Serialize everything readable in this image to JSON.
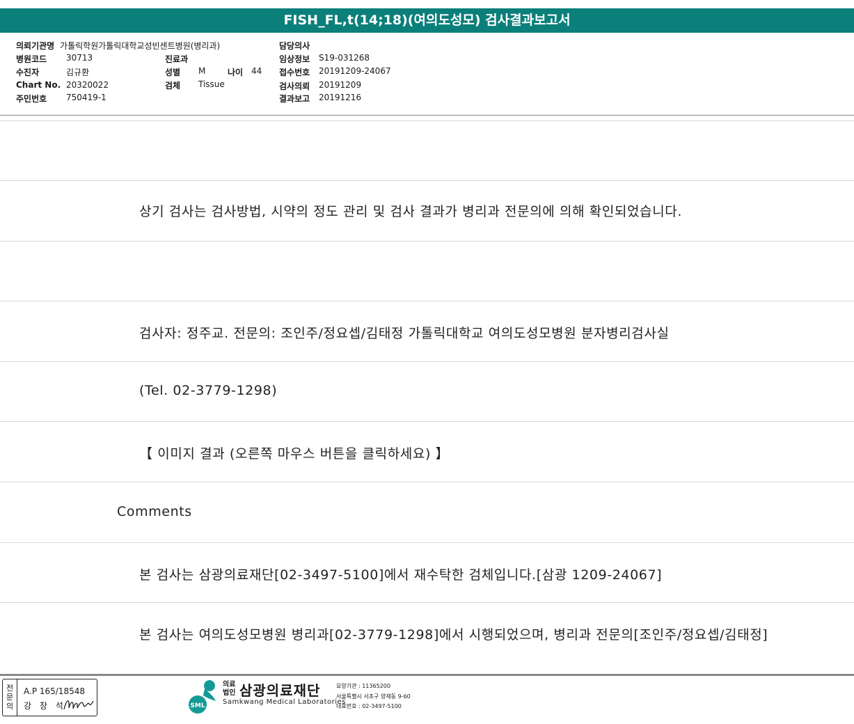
{
  "title": "FISH_FL,t(14;18)(여의도성모) 검사결과보고서",
  "header": {
    "institution_label": "의뢰기관명",
    "institution_value": "가톨릭학원가톨릭대학교성빈센트병원(병리과)",
    "hospital_code_label": "병원코드",
    "hospital_code_value": "30713",
    "recipient_label": "수진자",
    "recipient_value": "김규환",
    "chart_no_label": "Chart No.",
    "chart_no_value": "20320022",
    "resident_no_label": "주민번호",
    "resident_no_value": "750419-1",
    "department_label": "진료과",
    "department_value": "",
    "sex_label": "성별",
    "sex_value": "M",
    "age_label": "나이",
    "age_value": "44",
    "specimen_label": "검체",
    "specimen_value": "Tissue",
    "doctor_label": "담당의사",
    "doctor_value": "",
    "clinical_info_label": "임상정보",
    "clinical_info_value": "S19-031268",
    "receipt_no_label": "접수번호",
    "receipt_no_value": "20191209-24067",
    "test_request_label": "검사의뢰",
    "test_request_value": "20191209",
    "result_report_label": "결과보고",
    "result_report_value": "20191216"
  },
  "body": {
    "line_confirm": "상기 검사는 검사방법, 시약의 정도 관리 및 검사 결과가 병리과 전문의에 의해 확인되었습니다.",
    "line_examiner": "검사자: 정주교. 전문의: 조인주/정요셉/김태정 가톨릭대학교 여의도성모병원 분자병리검사실",
    "line_tel": "(Tel. 02-3779-1298)",
    "line_image": "【 이미지 결과 (오른쪽 마우스 버튼을 클릭하세요) 】",
    "comments_heading": "Comments",
    "line_outsourced": "본 검사는 삼광의료재단[02-3497-5100]에서 재수탁한 검체입니다.[삼광 1209-24067]",
    "line_performed": "본 검사는 여의도성모병원 병리과[02-3779-1298]에서 시행되었으며, 병리과 전문의[조인주/정요셉/김태정]"
  },
  "footer": {
    "stamp_side": "전문의",
    "stamp_line1": "A.P 165/18548",
    "stamp_line2": "강 창 석",
    "logo_text": "SML",
    "org_prefix_line1": "의료",
    "org_prefix_line2": "법인",
    "org_name": "삼광의료재단",
    "org_name_en": "Samkwang Medical Laboratories",
    "org_code": "요양기관 : 11365200",
    "org_address": "서울특별시 서초구 양재동 9-60",
    "org_phone": "대표번호 : 02-3497-5100"
  },
  "colors": {
    "title_bar": "#0b7f7a",
    "logo_teal": "#149a96"
  }
}
